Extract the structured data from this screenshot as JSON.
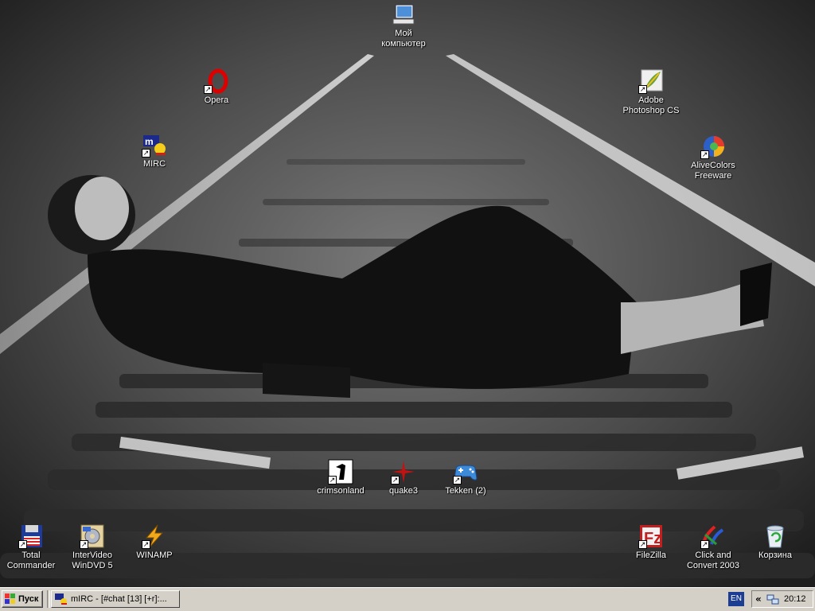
{
  "desktop": {
    "icons": {
      "my_computer": {
        "label": "Мой\nкомпьютер"
      },
      "opera": {
        "label": "Opera"
      },
      "mirc": {
        "label": "MIRC"
      },
      "photoshop": {
        "label": "Adobe\nPhotoshop CS"
      },
      "alivecolors": {
        "label": "AliveColors\nFreeware"
      },
      "crimsonland": {
        "label": "crimsonland"
      },
      "quake3": {
        "label": "quake3"
      },
      "tekken": {
        "label": "Tekken (2)"
      },
      "total_commander": {
        "label": "Total\nCommander"
      },
      "interVideo": {
        "label": "InterVideo\nWinDVD 5"
      },
      "winamp": {
        "label": "WINAMP"
      },
      "filezilla": {
        "label": "FileZilla"
      },
      "click_convert": {
        "label": "Click and\nConvert 2003"
      },
      "recycle_bin": {
        "label": "Корзина"
      }
    }
  },
  "taskbar": {
    "start_label": "Пуск",
    "tasks": [
      {
        "label": "mIRC - [#chat [13] [+r]:..."
      }
    ],
    "language": "EN",
    "tray_chevron": "«",
    "clock": "20:12"
  },
  "colors": {
    "taskbar": "#d4d0c8",
    "lang_badge": "#1b3e92",
    "label_text": "#ffffff"
  }
}
